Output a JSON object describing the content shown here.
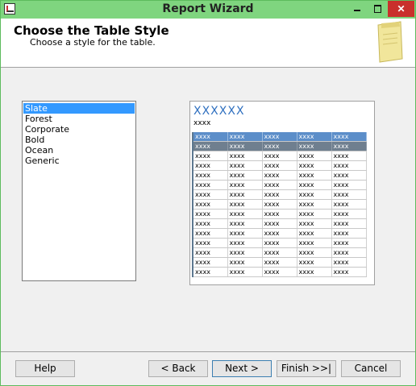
{
  "window": {
    "title": "Report Wizard"
  },
  "header": {
    "title": "Choose the Table Style",
    "subtitle": "Choose a style for the table."
  },
  "style_list": {
    "items": [
      "Slate",
      "Forest",
      "Corporate",
      "Bold",
      "Ocean",
      "Generic"
    ],
    "selected_index": 0
  },
  "preview": {
    "title": "XXXXXX",
    "subtitle": "xxxx",
    "cell": "xxxx",
    "columns": 5,
    "rows": 15
  },
  "buttons": {
    "help": "Help",
    "back": "< Back",
    "next": "Next >",
    "finish": "Finish >>|",
    "cancel": "Cancel"
  },
  "colors": {
    "titlebar": "#7fd57f",
    "selection": "#3399ff",
    "preview_title": "#2e6fbf",
    "preview_header": "#5c8ec9",
    "preview_group": "#6f7f8f"
  }
}
